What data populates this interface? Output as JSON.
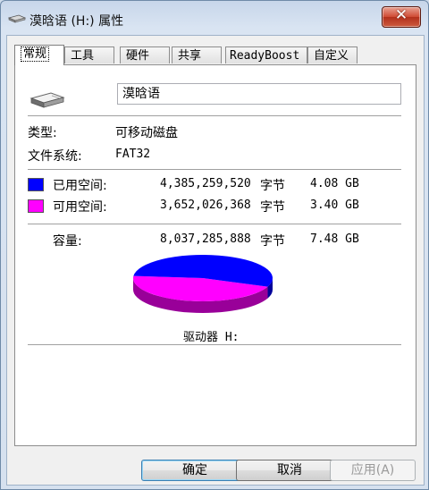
{
  "window": {
    "title": "漠晗语 (H:) 属性",
    "close_glyph": "✕"
  },
  "tabs": [
    {
      "label": "常规",
      "active": true
    },
    {
      "label": "工具"
    },
    {
      "label": "硬件"
    },
    {
      "label": "共享"
    },
    {
      "label": "ReadyBoost"
    },
    {
      "label": "自定义"
    }
  ],
  "general": {
    "drive_name": "漠晗语",
    "type_label": "类型:",
    "type_value": "可移动磁盘",
    "fs_label": "文件系统:",
    "fs_value": "FAT32",
    "used": {
      "label": "已用空间:",
      "bytes": "4,385,259,520",
      "unit": "字节",
      "size": "4.08 GB",
      "color": "#0000ff"
    },
    "free": {
      "label": "可用空间:",
      "bytes": "3,652,026,368",
      "unit": "字节",
      "size": "3.40 GB",
      "color": "#ff00ff"
    },
    "capacity": {
      "label": "容量:",
      "bytes": "8,037,285,888",
      "unit": "字节",
      "size": "7.48 GB"
    },
    "drive_label": "驱动器 H:",
    "used_fraction": 0.5456
  },
  "buttons": {
    "ok": "确定",
    "cancel": "取消",
    "apply": "应用(A)"
  },
  "icons": {
    "title": "usb-drive-icon",
    "drive": "removable-disk-icon"
  }
}
